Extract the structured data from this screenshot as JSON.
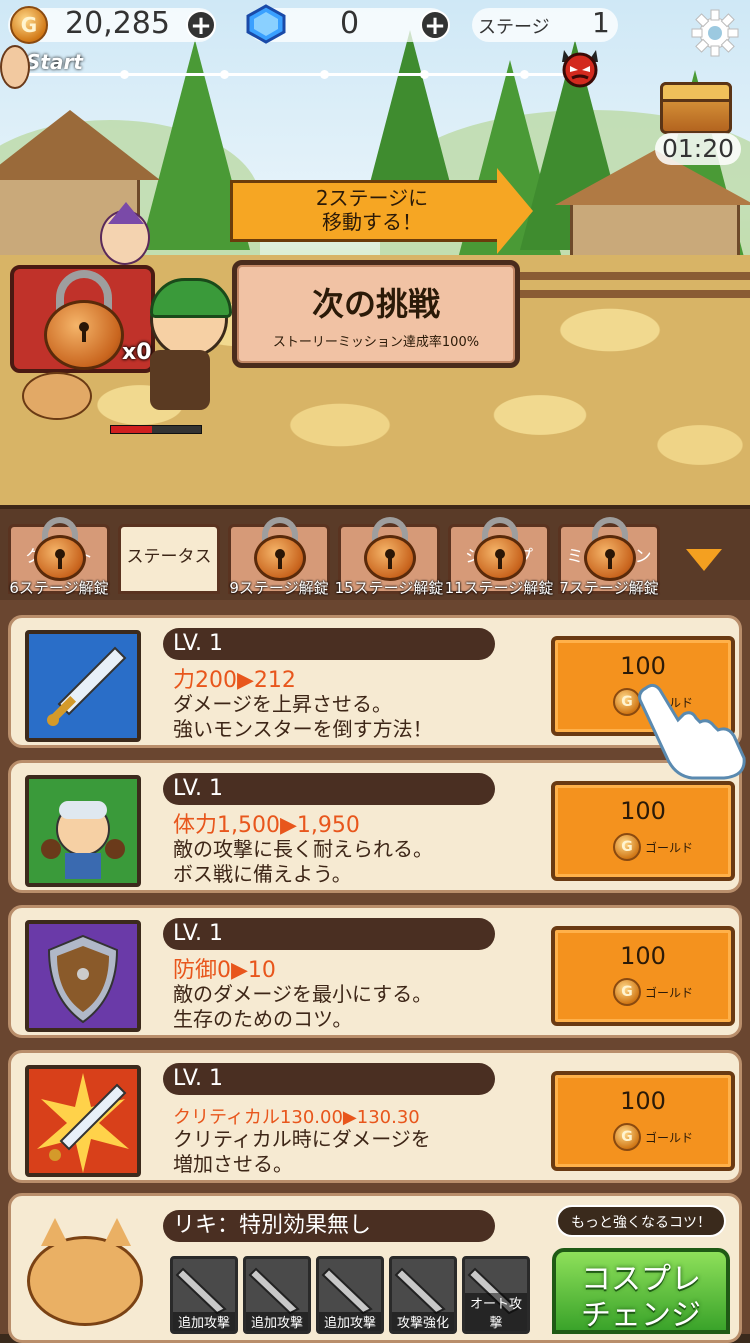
{
  "hud": {
    "coin_symbol": "G",
    "gold": "20,285",
    "gems": "0",
    "stage_label": "ステージ",
    "stage_number": "1",
    "start_label": "Start",
    "timer": "01:20"
  },
  "scene": {
    "move_sign": "2ステージに\n移動する！",
    "challenge_title": "次の挑戦",
    "challenge_sub": "ストーリーミッション達成率100%",
    "lock_count": "x0",
    "hp_fraction": 0.45
  },
  "tabs": [
    {
      "label": "クエスト",
      "locked": true,
      "unlock": "6ステージ解錠"
    },
    {
      "label": "ステータス",
      "locked": false,
      "unlock": ""
    },
    {
      "label": "スキル",
      "locked": true,
      "unlock": "9ステージ解錠"
    },
    {
      "label": "装備",
      "locked": true,
      "unlock": "15ステージ解錠"
    },
    {
      "label": "ショップ",
      "locked": true,
      "unlock": "11ステージ解錠"
    },
    {
      "label": "ミッション",
      "locked": true,
      "unlock": "7ステージ解錠"
    }
  ],
  "upgrades": [
    {
      "level": "LV. 1",
      "stat": "力200▶212",
      "desc1": "ダメージを上昇させる。",
      "desc2": "強いモンスターを倒す方法！",
      "price": "100",
      "unit": "ゴールド",
      "icon": "sword-icon",
      "color": "#2a6ec8"
    },
    {
      "level": "LV. 1",
      "stat": "体力1,500▶1,950",
      "desc1": "敵の攻撃に長く耐えられる。",
      "desc2": "ボス戦に備えよう。",
      "price": "100",
      "unit": "ゴールド",
      "icon": "hero-icon",
      "color": "#3a9a3a"
    },
    {
      "level": "LV. 1",
      "stat": "防御0▶10",
      "desc1": "敵のダメージを最小にする。",
      "desc2": "生存のためのコツ。",
      "price": "100",
      "unit": "ゴールド",
      "icon": "shield-icon",
      "color": "#6a3aa8"
    },
    {
      "level": "LV. 1",
      "stat": "クリティカル130.00▶130.30",
      "desc1": "クリティカル時にダメージを",
      "desc2": "増加させる。",
      "price": "100",
      "unit": "ゴールド",
      "icon": "critical-sword-icon",
      "color": "#d8401a"
    }
  ],
  "pet": {
    "name": "リキ：特別効果無し",
    "slots": [
      "追加攻撃",
      "追加攻撃",
      "追加攻撃",
      "攻撃強化",
      "オート攻撃"
    ],
    "tip": "もっと強くなるコツ！",
    "cosplay_button": "コスプレ\nチェンジ"
  }
}
